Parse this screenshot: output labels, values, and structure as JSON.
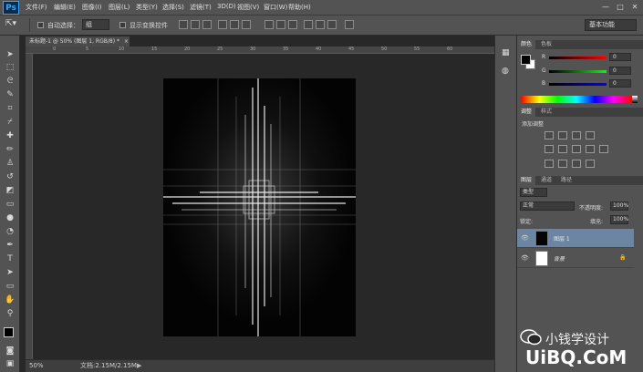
{
  "app": {
    "logo": "Ps"
  },
  "menu": [
    "文件(F)",
    "编辑(E)",
    "图像(I)",
    "图层(L)",
    "类型(Y)",
    "选择(S)",
    "滤镜(T)",
    "3D(D)",
    "视图(V)",
    "窗口(W)",
    "帮助(H)"
  ],
  "window_controls": {
    "minimize": "—",
    "maximize": "□",
    "close": "✕"
  },
  "options": {
    "auto_select_label": "自动选择：",
    "auto_select_value": "组",
    "show_transform_label": "显示变换控件",
    "workspace": "基本功能"
  },
  "document": {
    "tab_title": "未标题-1 @ 50% (图层 1, RGB/8) *",
    "tab_close": "×",
    "zoom": "50%",
    "doc_info": "文档:2.15M/2.15M",
    "ruler_marks": [
      "0",
      "5",
      "10",
      "15",
      "20",
      "25",
      "30",
      "35",
      "40",
      "45",
      "50",
      "55",
      "60"
    ]
  },
  "color_panel": {
    "tabs": [
      "颜色",
      "色板"
    ],
    "channels": [
      {
        "label": "R",
        "value": "0",
        "color": "#e03030"
      },
      {
        "label": "G",
        "value": "0",
        "color": "#30b030"
      },
      {
        "label": "B",
        "value": "0",
        "color": "#3050e0"
      }
    ]
  },
  "adjustments_panel": {
    "tabs": [
      "调整",
      "样式"
    ],
    "title": "添加调整"
  },
  "layers_panel": {
    "tabs": [
      "图层",
      "通道",
      "路径"
    ],
    "filter": "类型",
    "blend_mode": "正常",
    "opacity_label": "不透明度:",
    "opacity_value": "100%",
    "lock_label": "锁定:",
    "fill_label": "填充:",
    "fill_value": "100%",
    "layers": [
      {
        "name": "图层 1",
        "selected": true
      },
      {
        "name": "背景",
        "selected": false
      }
    ]
  },
  "watermark": {
    "line1": "小钱学设计",
    "line2": "UiBQ.CoM"
  },
  "colors": {
    "chrome": "#535353",
    "canvas_bg": "#282828",
    "selected_layer": "#6c85a3",
    "accent": "#31a8ff"
  }
}
